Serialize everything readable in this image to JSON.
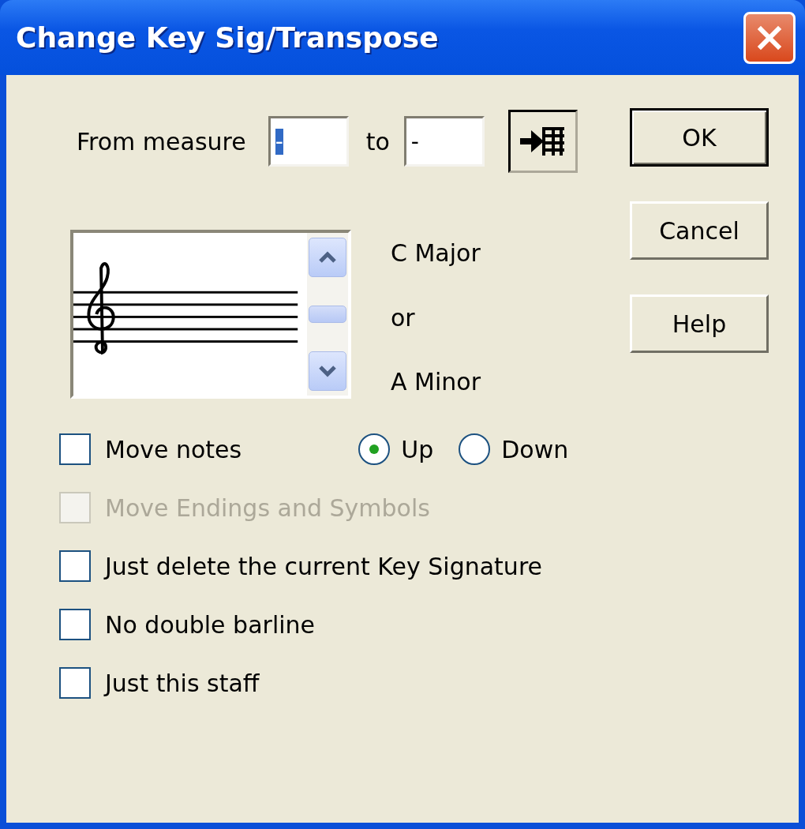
{
  "window": {
    "title": "Change Key Sig/Transpose"
  },
  "range": {
    "from_label": "From measure",
    "from_value": "-",
    "from_value_selected": true,
    "to_label": "to",
    "to_value": "-"
  },
  "key_signature": {
    "major": "C Major",
    "joiner": "or",
    "minor": "A Minor"
  },
  "options": [
    {
      "label": "Move notes",
      "checked": false,
      "disabled": false
    },
    {
      "label": "Move Endings and Symbols",
      "checked": false,
      "disabled": true
    },
    {
      "label": "Just delete the current Key Signature",
      "checked": false,
      "disabled": false
    },
    {
      "label": "No double barline",
      "checked": false,
      "disabled": false
    },
    {
      "label": "Just this staff",
      "checked": false,
      "disabled": false
    }
  ],
  "direction": [
    {
      "label": "Up",
      "selected": true
    },
    {
      "label": "Down",
      "selected": false
    }
  ],
  "buttons": [
    {
      "label": "OK",
      "default": true
    },
    {
      "label": "Cancel",
      "default": false
    },
    {
      "label": "Help",
      "default": false
    }
  ]
}
